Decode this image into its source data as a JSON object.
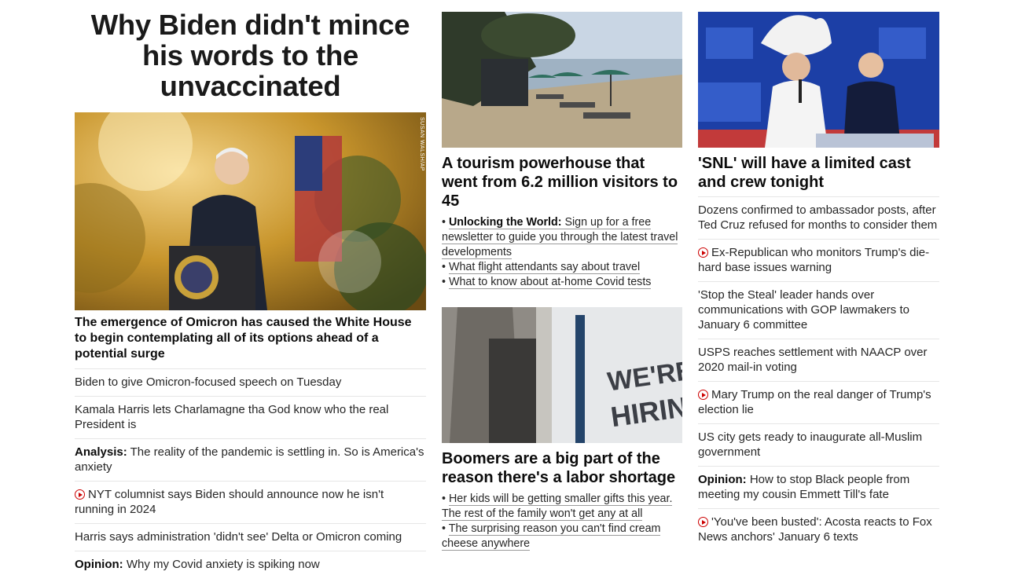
{
  "col1": {
    "headline": "Why Biden didn't mince his words to the unvaccinated",
    "image_credit": "SUSAN WALSH/AP",
    "lead": "The emergence of Omicron has caused the White House to begin contemplating all of its options ahead of a potential surge",
    "items": [
      {
        "prefix": "",
        "text": "Biden to give Omicron-focused speech on Tuesday"
      },
      {
        "prefix": "",
        "text": "Kamala Harris lets Charlamagne tha God know who the real President is"
      },
      {
        "prefix": "Analysis:",
        "text": "The reality of the pandemic is settling in. So is America's anxiety"
      },
      {
        "prefix": "",
        "text": "NYT columnist says Biden should announce now he isn't running in 2024"
      },
      {
        "prefix": "",
        "text": "Harris says administration 'didn't see' Delta or Omicron coming"
      },
      {
        "prefix": "Opinion:",
        "text": "Why my Covid anxiety is spiking now"
      }
    ]
  },
  "col2": {
    "card1": {
      "title": "A tourism powerhouse that went from 6.2 million visitors to 45",
      "bullets": [
        {
          "bold": "Unlocking the World:",
          "text": "Sign up for a free newsletter to guide you through the latest travel developments"
        },
        {
          "bold": "",
          "text": "What flight attendants say about travel"
        },
        {
          "bold": "",
          "text": "What to know about at-home Covid tests"
        }
      ]
    },
    "card2": {
      "sign_line1": "WE'RE",
      "sign_line2": "HIRING!",
      "title": "Boomers are a big part of the reason there's a labor shortage",
      "bullets": [
        {
          "bold": "",
          "text": "Her kids will be getting smaller gifts this year. The rest of the family won't get any at all"
        },
        {
          "bold": "",
          "text": "The surprising reason you can't find cream cheese anywhere"
        }
      ]
    }
  },
  "col3": {
    "title": "'SNL' will have a limited cast and crew tonight",
    "items": [
      {
        "prefix": "",
        "text": "Dozens confirmed to ambassador posts, after Ted Cruz refused for months to consider them"
      },
      {
        "prefix": "",
        "text": "Ex-Republican who monitors Trump's die-hard base issues warning"
      },
      {
        "prefix": "",
        "text": "'Stop the Steal' leader hands over communications with GOP lawmakers to January 6 committee"
      },
      {
        "prefix": "",
        "text": "USPS reaches settlement with NAACP over 2020 mail-in voting"
      },
      {
        "prefix": "",
        "text": "Mary Trump on the real danger of Trump's election lie"
      },
      {
        "prefix": "",
        "text": "US city gets ready to inaugurate all-Muslim government"
      },
      {
        "prefix": "Opinion:",
        "text": "How to stop Black people from meeting my cousin Emmett Till's fate"
      },
      {
        "prefix": "",
        "text": "'You've been busted': Acosta reacts to Fox News anchors' January 6 texts"
      }
    ]
  },
  "colors": {
    "video_red": "#cc0000",
    "divider": "#e6e6e6"
  },
  "icons": {
    "video": "play-circle-icon"
  }
}
